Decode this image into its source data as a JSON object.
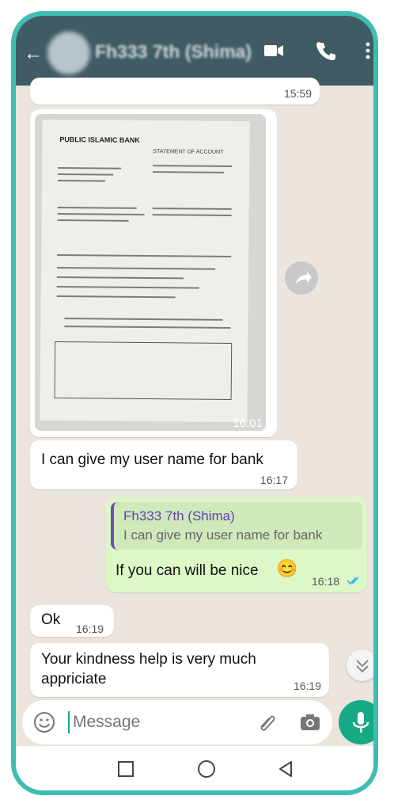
{
  "header": {
    "title": "Fh333 7th (Shima)",
    "icons": [
      "back-arrow-icon",
      "video-call-icon",
      "phone-icon",
      "more-vert-icon"
    ]
  },
  "messages": [
    {
      "type": "incoming",
      "time": "15:59"
    },
    {
      "type": "incoming-image",
      "time": "16:01",
      "document_title": "PUBLIC ISLAMIC BANK",
      "document_subtitle": "STATEMENT OF ACCOUNT"
    },
    {
      "type": "incoming",
      "text": "I can give my user name for bank",
      "time": "16:17"
    },
    {
      "type": "outgoing",
      "quote_author": "Fh333 7th (Shima)",
      "quote_text": "I can give my user name for bank",
      "text": "If you can will be nice",
      "emoji": "😊",
      "time": "16:18",
      "status": "read"
    },
    {
      "type": "incoming",
      "text": "Ok",
      "time": "16:19"
    },
    {
      "type": "incoming",
      "text": "Your kindness help is very much\nappriciate",
      "time": "16:19"
    }
  ],
  "composer": {
    "placeholder": "Message",
    "icons": [
      "emoji-icon",
      "attach-icon",
      "camera-icon",
      "mic-icon"
    ]
  },
  "navbar": [
    "recent-apps-icon",
    "home-icon",
    "back-icon"
  ],
  "colors": {
    "frame": "#3fbdb4",
    "header": "#3f5b63",
    "chat": "#ece5dd",
    "outgoing": "#dcf8c6",
    "mic": "#17a884"
  }
}
